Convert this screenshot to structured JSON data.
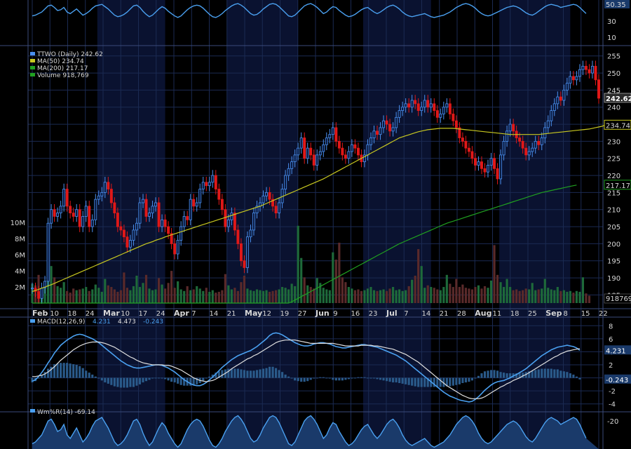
{
  "chart_data": {
    "type": "line",
    "colors": {
      "background": "#000000",
      "band": "#0a1230",
      "grid": "#1b2a52",
      "price": "#4a90f0",
      "down": "#e01818",
      "ma50": "#c8c820",
      "ma200": "#20a020",
      "volume": "#1e6a3a",
      "volume_down": "#5a2a2a",
      "macd": "#4aa0f0",
      "signal": "#e0e0e0",
      "hist": "#2a5a8a",
      "text": "#d8d8d8",
      "williams": "#4aa0f0"
    },
    "top_panel": {
      "value_label": "50.35",
      "ticks": [
        "30",
        "10"
      ]
    },
    "price_panel": {
      "legend": [
        {
          "text": "TTWO (Daily) 242.62",
          "color": "#4a90f0"
        },
        {
          "text": "MA(50) 234.74",
          "color": "#c8c820"
        },
        {
          "text": "MA(200) 217.17",
          "color": "#20a020"
        },
        {
          "text": "Volume 918,769",
          "color": "#20a020"
        }
      ],
      "price_ticks": [
        "255",
        "250",
        "245",
        "240",
        "235",
        "230",
        "225",
        "220",
        "215",
        "210",
        "205",
        "200",
        "195",
        "190",
        "185"
      ],
      "volume_ticks": [
        "10M",
        "8M",
        "6M",
        "4M",
        "2M"
      ],
      "last_price_label": "242.62",
      "ma50_label": "234.74",
      "ma200_label": "217.17",
      "volume_label": "918769",
      "x_ticks": [
        "Feb",
        "10",
        "18",
        "24",
        "Mar",
        "10",
        "17",
        "24",
        "Apr",
        "7",
        "14",
        "21",
        "May",
        "12",
        "19",
        "27",
        "Jun",
        "9",
        "16",
        "23",
        "Jul",
        "7",
        "14",
        "21",
        "28",
        "Aug",
        "11",
        "18",
        "25",
        "Sep",
        "8",
        "15",
        "22"
      ]
    },
    "macd_panel": {
      "legend_name": "MACD(12,26,9)",
      "legend_values": [
        "4.231",
        "4.473",
        "-0.243"
      ],
      "ticks": [
        "8",
        "6",
        "4",
        "2",
        "-2",
        "-4"
      ],
      "macd_label": "4.231",
      "hist_label": "-0.243"
    },
    "williams_panel": {
      "legend": "Wm%R(14) -69.14",
      "ticks": [
        "-20"
      ]
    },
    "price_close": [
      187,
      186,
      184,
      187,
      189,
      206,
      210,
      208,
      209,
      211,
      216,
      211,
      209,
      208,
      210,
      205,
      208,
      211,
      205,
      207,
      213,
      214,
      215,
      218,
      216,
      212,
      209,
      205,
      204,
      202,
      199,
      201,
      204,
      206,
      212,
      213,
      208,
      209,
      211,
      212,
      205,
      207,
      205,
      203,
      200,
      197,
      201,
      205,
      208,
      207,
      213,
      211,
      212,
      216,
      218,
      217,
      218,
      220,
      216,
      213,
      210,
      205,
      207,
      209,
      204,
      200,
      195,
      193,
      202,
      204,
      209,
      211,
      212,
      214,
      215,
      213,
      211,
      209,
      212,
      216,
      220,
      222,
      224,
      226,
      228,
      231,
      225,
      228,
      226,
      223,
      226,
      227,
      229,
      231,
      232,
      234,
      230,
      228,
      226,
      225,
      227,
      229,
      228,
      226,
      224,
      226,
      229,
      231,
      233,
      232,
      234,
      236,
      235,
      233,
      234,
      237,
      239,
      240,
      241,
      240,
      242,
      241,
      239,
      240,
      242,
      240,
      241,
      239,
      237,
      238,
      240,
      241,
      238,
      236,
      234,
      231,
      230,
      228,
      227,
      225,
      223,
      224,
      222,
      221,
      223,
      225,
      222,
      219,
      226,
      230,
      233,
      235,
      233,
      231,
      230,
      228,
      226,
      227,
      228,
      230,
      229,
      231,
      234,
      236,
      239,
      241,
      243,
      242,
      245,
      247,
      249,
      248,
      249,
      251,
      252,
      251,
      250,
      252,
      248,
      242.62
    ],
    "ma50": [
      186,
      186.3,
      186.6,
      187,
      187.3,
      187.7,
      188,
      188.4,
      188.8,
      189.2,
      189.6,
      190,
      190.4,
      190.8,
      191.2,
      191.6,
      192,
      192.4,
      192.8,
      193.2,
      193.6,
      194,
      194.4,
      194.8,
      195.2,
      195.6,
      196,
      196.4,
      196.8,
      197.2,
      197.6,
      198,
      198.4,
      198.8,
      199.2,
      199.6,
      200,
      200.3,
      200.6,
      201,
      201.3,
      201.6,
      202,
      202.3,
      202.6,
      202.9,
      203.2,
      203.5,
      203.8,
      204.1,
      204.4,
      204.7,
      205,
      205.3,
      205.6,
      205.9,
      206.2,
      206.5,
      206.8,
      207.1,
      207.4,
      207.7,
      208,
      208.3,
      208.6,
      208.9,
      209.2,
      209.5,
      209.8,
      210.1,
      210.4,
      210.7,
      211,
      211.4,
      211.8,
      212.2,
      212.6,
      213,
      213.4,
      213.8,
      214.2,
      214.6,
      215,
      215.4,
      215.8,
      216.2,
      216.6,
      217,
      217.4,
      217.8,
      218.2,
      218.6,
      219,
      219.5,
      220,
      220.5,
      221,
      221.5,
      222,
      222.5,
      223,
      223.5,
      224,
      224.5,
      225,
      225.5,
      226,
      226.5,
      227,
      227.5,
      228,
      228.5,
      229,
      229.5,
      230,
      230.5,
      231,
      231.3,
      231.6,
      231.9,
      232.2,
      232.5,
      232.8,
      233,
      233.2,
      233.4,
      233.5,
      233.6,
      233.7,
      233.8,
      233.8,
      233.8,
      233.8,
      233.8,
      233.7,
      233.6,
      233.5,
      233.4,
      233.3,
      233.2,
      233.1,
      233,
      232.9,
      232.8,
      232.7,
      232.6,
      232.5,
      232.4,
      232.3,
      232.2,
      232.1,
      232,
      232,
      232,
      232,
      232,
      232,
      232,
      232,
      232,
      232,
      232.1,
      232.2,
      232.3,
      232.4,
      232.5,
      232.6,
      232.7,
      232.8,
      232.9,
      233,
      233.1,
      233.2,
      233.3,
      233.4,
      233.5,
      233.6,
      233.8,
      234,
      234.2,
      234.4,
      234.74
    ],
    "ma200": [
      150,
      150.4,
      150.8,
      151.2,
      151.6,
      152,
      152.4,
      152.8,
      153.2,
      153.6,
      154,
      154.4,
      154.8,
      155.2,
      155.6,
      156,
      156.4,
      156.8,
      157.2,
      157.6,
      158,
      158.4,
      158.8,
      159.2,
      159.6,
      160,
      160.4,
      160.8,
      161.2,
      161.6,
      162,
      162.4,
      162.8,
      163.2,
      163.6,
      164,
      164.4,
      164.8,
      165.2,
      165.6,
      166,
      166.4,
      166.8,
      167.2,
      167.6,
      168,
      168.4,
      168.8,
      169.2,
      169.6,
      170,
      170.4,
      170.8,
      171.2,
      171.6,
      172,
      172.4,
      172.8,
      173.2,
      173.6,
      174,
      174.4,
      174.8,
      175.2,
      175.6,
      176,
      176.4,
      176.8,
      177.2,
      177.6,
      178,
      178.4,
      178.8,
      179.2,
      179.6,
      180,
      180.4,
      180.8,
      181.2,
      181.6,
      182,
      182.5,
      183,
      183.5,
      184,
      184.5,
      185,
      185.5,
      186,
      186.5,
      187,
      187.5,
      188,
      188.5,
      189,
      189.5,
      190,
      190.5,
      191,
      191.5,
      192,
      192.5,
      193,
      193.5,
      194,
      194.5,
      195,
      195.5,
      196,
      196.5,
      197,
      197.5,
      198,
      198.5,
      199,
      199.5,
      200,
      200.4,
      200.8,
      201.2,
      201.6,
      202,
      202.4,
      202.8,
      203.2,
      203.6,
      204,
      204.4,
      204.8,
      205.2,
      205.6,
      206,
      206.3,
      206.6,
      206.9,
      207.2,
      207.5,
      207.8,
      208.1,
      208.4,
      208.7,
      209,
      209.3,
      209.6,
      209.9,
      210.2,
      210.5,
      210.8,
      211.1,
      211.4,
      211.7,
      212,
      212.3,
      212.6,
      212.9,
      213.2,
      213.5,
      213.8,
      214.1,
      214.4,
      214.7,
      215,
      215.2,
      215.4,
      215.6,
      215.8,
      216,
      216.2,
      216.4,
      216.6,
      216.8,
      217,
      217.17
    ],
    "volume_m": [
      2.4,
      2.2,
      3.5,
      1.6,
      1.8,
      8.5,
      4.6,
      3.2,
      2.1,
      1.9,
      2.6,
      1.5,
      1.3,
      1.8,
      1.6,
      1.7,
      1.8,
      2.0,
      1.5,
      1.7,
      2.3,
      1.9,
      1.4,
      3.0,
      2.2,
      2.0,
      1.7,
      1.4,
      1.6,
      3.8,
      1.9,
      1.6,
      2.1,
      3.4,
      2.0,
      2.5,
      3.5,
      1.8,
      1.6,
      1.7,
      3.1,
      2.3,
      1.8,
      2.5,
      4.0,
      1.9,
      2.7,
      1.7,
      1.5,
      2.1,
      1.6,
      1.7,
      2.1,
      1.8,
      1.5,
      1.9,
      1.4,
      1.6,
      1.3,
      1.4,
      1.6,
      3.6,
      2.2,
      1.7,
      1.9,
      1.5,
      2.6,
      3.4,
      1.8,
      1.6,
      1.5,
      1.7,
      1.6,
      1.5,
      1.6,
      1.4,
      1.5,
      1.6,
      1.7,
      2.0,
      1.9,
      1.7,
      2.4,
      2.1,
      9.6,
      5.6,
      3.2,
      2.2,
      2.0,
      1.8,
      3.1,
      2.5,
      1.9,
      1.7,
      1.6,
      6.3,
      5.4,
      7.5,
      3.2,
      2.6,
      2.0,
      1.8,
      1.6,
      1.7,
      1.5,
      1.6,
      1.8,
      2.0,
      1.6,
      1.5,
      1.6,
      1.7,
      1.5,
      1.8,
      2.0,
      1.6,
      1.7,
      1.5,
      1.6,
      2.1,
      2.9,
      3.4,
      6.7,
      4.6,
      1.9,
      2.2,
      2.0,
      1.9,
      1.7,
      1.6,
      2.0,
      3.5,
      2.4,
      2.0,
      3.0,
      2.0,
      2.3,
      1.9,
      1.8,
      1.7,
      2.0,
      2.2,
      1.8,
      2.1,
      1.9,
      2.8,
      7.2,
      3.5,
      2.6,
      2.0,
      3.0,
      2.0,
      1.6,
      1.7,
      1.5,
      1.6,
      1.8,
      1.7,
      2.5,
      1.6,
      1.7,
      1.8,
      3.0,
      1.9,
      1.7,
      1.6,
      2.0,
      1.5,
      1.6,
      1.4,
      1.5,
      1.3,
      1.5,
      1.4,
      3.2,
      1.2,
      0.92
    ],
    "macd": [
      -0.5,
      -0.3,
      0.2,
      0.8,
      1.5,
      2.3,
      3.0,
      3.8,
      4.4,
      5.0,
      5.4,
      5.8,
      6.1,
      6.4,
      6.6,
      6.7,
      6.6,
      6.4,
      6.2,
      6.0,
      5.7,
      5.4,
      5.0,
      4.6,
      4.2,
      3.8,
      3.4,
      3.0,
      2.6,
      2.3,
      2.0,
      1.8,
      1.6,
      1.5,
      1.5,
      1.6,
      1.7,
      1.8,
      1.9,
      2.0,
      2.0,
      1.9,
      1.7,
      1.5,
      1.2,
      0.9,
      0.5,
      0.1,
      -0.3,
      -0.6,
      -0.9,
      -1.1,
      -1.2,
      -1.2,
      -1.0,
      -0.7,
      -0.3,
      0.1,
      0.6,
      1.1,
      1.6,
      2.0,
      2.4,
      2.8,
      3.1,
      3.4,
      3.6,
      3.8,
      4.0,
      4.2,
      4.5,
      4.8,
      5.2,
      5.6,
      6.0,
      6.5,
      6.8,
      6.9,
      6.8,
      6.6,
      6.3,
      6.0,
      5.7,
      5.4,
      5.2,
      5.0,
      4.9,
      4.9,
      5.0,
      5.2,
      5.3,
      5.4,
      5.4,
      5.3,
      5.2,
      5.0,
      4.8,
      4.7,
      4.6,
      4.6,
      4.7,
      4.8,
      4.9,
      5.0,
      5.1,
      5.1,
      5.0,
      4.9,
      4.8,
      4.7,
      4.5,
      4.3,
      4.1,
      3.9,
      3.7,
      3.5,
      3.2,
      2.9,
      2.6,
      2.2,
      1.8,
      1.4,
      1.0,
      0.6,
      0.2,
      -0.2,
      -0.6,
      -1.0,
      -1.4,
      -1.8,
      -2.2,
      -2.5,
      -2.8,
      -3.0,
      -3.2,
      -3.4,
      -3.5,
      -3.6,
      -3.7,
      -3.6,
      -3.3,
      -2.9,
      -2.4,
      -1.9,
      -1.5,
      -1.1,
      -0.8,
      -0.6,
      -0.5,
      -0.4,
      -0.2,
      0.0,
      0.3,
      0.5,
      0.8,
      1.1,
      1.4,
      1.8,
      2.2,
      2.6,
      3.0,
      3.4,
      3.7,
      4.0,
      4.3,
      4.5,
      4.7,
      4.8,
      4.9,
      5.0,
      4.9,
      4.8,
      4.6,
      4.231
    ],
    "signal": [
      0.2,
      0.2,
      0.3,
      0.4,
      0.6,
      0.9,
      1.3,
      1.7,
      2.2,
      2.7,
      3.1,
      3.5,
      3.9,
      4.3,
      4.6,
      4.9,
      5.1,
      5.3,
      5.4,
      5.5,
      5.5,
      5.5,
      5.4,
      5.3,
      5.1,
      4.9,
      4.7,
      4.4,
      4.1,
      3.8,
      3.5,
      3.2,
      3.0,
      2.7,
      2.5,
      2.3,
      2.2,
      2.1,
      2.0,
      2.0,
      2.0,
      2.0,
      1.9,
      1.9,
      1.8,
      1.6,
      1.4,
      1.2,
      0.9,
      0.6,
      0.3,
      0.0,
      -0.2,
      -0.4,
      -0.5,
      -0.6,
      -0.5,
      -0.4,
      -0.2,
      0.1,
      0.4,
      0.7,
      1.0,
      1.4,
      1.7,
      2.0,
      2.3,
      2.6,
      2.9,
      3.1,
      3.4,
      3.6,
      3.9,
      4.2,
      4.5,
      4.8,
      5.1,
      5.4,
      5.6,
      5.7,
      5.8,
      5.8,
      5.8,
      5.8,
      5.7,
      5.6,
      5.5,
      5.4,
      5.3,
      5.3,
      5.3,
      5.3,
      5.3,
      5.3,
      5.3,
      5.3,
      5.2,
      5.1,
      5.0,
      4.9,
      4.9,
      4.9,
      4.9,
      4.9,
      5.0,
      5.0,
      5.0,
      5.0,
      4.9,
      4.9,
      4.8,
      4.7,
      4.6,
      4.5,
      4.4,
      4.2,
      4.0,
      3.8,
      3.6,
      3.3,
      3.0,
      2.7,
      2.4,
      2.0,
      1.6,
      1.2,
      0.8,
      0.4,
      0.0,
      -0.4,
      -0.8,
      -1.2,
      -1.5,
      -1.8,
      -2.1,
      -2.4,
      -2.7,
      -2.9,
      -3.1,
      -3.2,
      -3.2,
      -3.2,
      -3.1,
      -2.9,
      -2.6,
      -2.3,
      -2.0,
      -1.7,
      -1.4,
      -1.2,
      -0.9,
      -0.7,
      -0.4,
      -0.2,
      0.0,
      0.3,
      0.5,
      0.8,
      1.1,
      1.4,
      1.7,
      2.0,
      2.3,
      2.6,
      2.9,
      3.2,
      3.4,
      3.7,
      3.9,
      4.1,
      4.2,
      4.3,
      4.4,
      4.473
    ],
    "williams": [
      -85,
      -80,
      -70,
      -60,
      -40,
      -20,
      -15,
      -30,
      -50,
      -45,
      -30,
      -60,
      -70,
      -55,
      -40,
      -60,
      -80,
      -70,
      -55,
      -35,
      -20,
      -15,
      -10,
      -25,
      -40,
      -60,
      -80,
      -90,
      -85,
      -75,
      -60,
      -40,
      -20,
      -15,
      -30,
      -55,
      -75,
      -90,
      -80,
      -60,
      -40,
      -25,
      -35,
      -55,
      -70,
      -85,
      -95,
      -85,
      -65,
      -45,
      -30,
      -20,
      -15,
      -20,
      -35,
      -55,
      -75,
      -90,
      -95,
      -85,
      -70,
      -50,
      -35,
      -20,
      -10,
      -5,
      -15,
      -30,
      -50,
      -70,
      -80,
      -75,
      -60,
      -40,
      -25,
      -10,
      -5,
      -10,
      -25,
      -45,
      -65,
      -85,
      -90,
      -80,
      -60,
      -40,
      -20,
      -10,
      -5,
      -15,
      -30,
      -50,
      -70,
      -60,
      -40,
      -25,
      -30,
      -50,
      -65,
      -80,
      -90,
      -85,
      -75,
      -60,
      -45,
      -35,
      -30,
      -45,
      -60,
      -70,
      -60,
      -45,
      -30,
      -20,
      -15,
      -25,
      -40,
      -60,
      -75,
      -85,
      -90,
      -85,
      -80,
      -75,
      -70,
      -80,
      -90,
      -95,
      -90,
      -85,
      -80,
      -70,
      -60,
      -45,
      -30,
      -20,
      -10,
      -5,
      -10,
      -20,
      -35,
      -55,
      -70,
      -80,
      -85,
      -80,
      -70,
      -60,
      -50,
      -40,
      -30,
      -25,
      -20,
      -25,
      -35,
      -50,
      -65,
      -75,
      -80,
      -70,
      -55,
      -40,
      -25,
      -15,
      -10,
      -15,
      -20,
      -30,
      -25,
      -20,
      -15,
      -10,
      -15,
      -30,
      -50,
      -69.14
    ]
  }
}
